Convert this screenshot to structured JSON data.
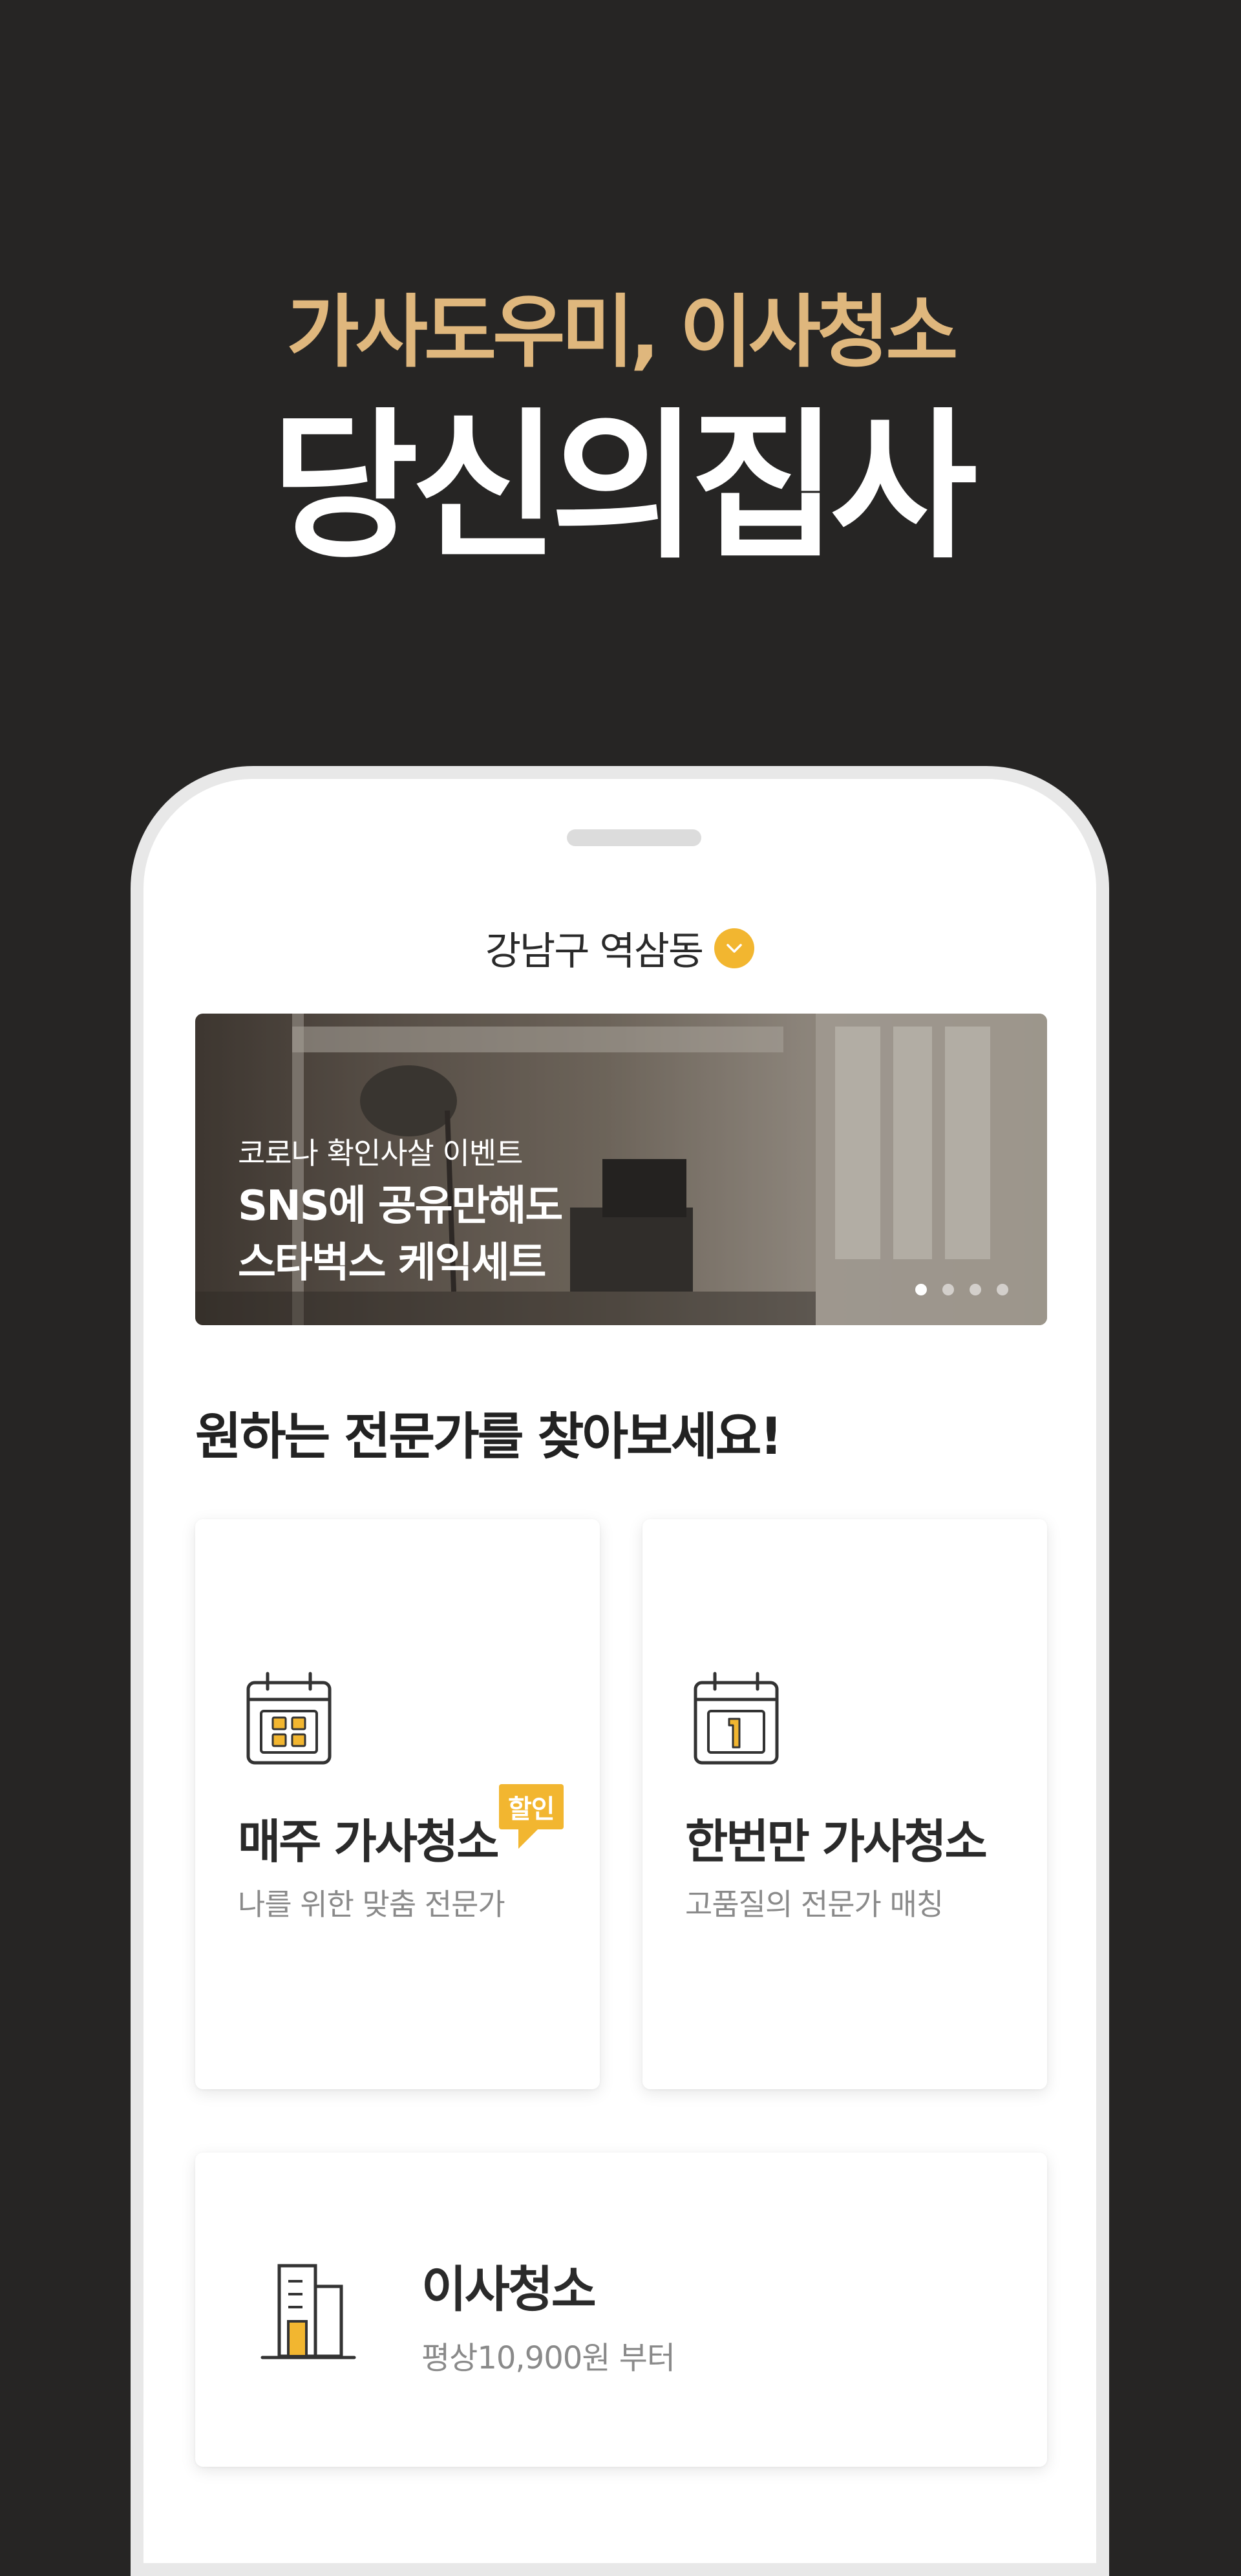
{
  "hero": {
    "subtitle": "가사도우미, 이사청소",
    "title": "당신의집사"
  },
  "location": {
    "label": "강남구 역삼동",
    "dropdown_icon": "chevron-down-icon",
    "accent": "#f2b630"
  },
  "banner": {
    "kicker": "코로나 확인사살 이벤트",
    "headline_line1": "SNS에 공유만해도",
    "headline_line2": "스타벅스 케익세트",
    "page_count": 4,
    "active_page": 1
  },
  "section": {
    "heading": "원하는 전문가를 찾아보세요!"
  },
  "services": [
    {
      "title": "매주 가사청소",
      "description": "나를 위한 맞춤 전문가",
      "badge": "할인",
      "icon": "calendar-grid-icon"
    },
    {
      "title": "한번만 가사청소",
      "description": "고품질의 전문가 매칭",
      "icon": "calendar-one-icon"
    }
  ],
  "moving": {
    "title": "이사청소",
    "description": "평상10,900원 부터",
    "icon": "building-icon"
  },
  "colors": {
    "background": "#262524",
    "gold_text": "#dfb77d",
    "accent": "#f2b630"
  }
}
